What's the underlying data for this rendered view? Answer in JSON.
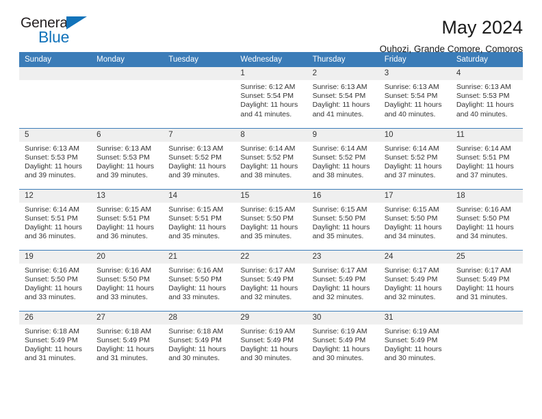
{
  "brand": {
    "name_top": "General",
    "name_bottom": "Blue",
    "accent_color": "#1273ba"
  },
  "header": {
    "title": "May 2024",
    "subtitle": "Ouhozi, Grande Comore, Comoros"
  },
  "calendar": {
    "header_color": "#3b7cb8",
    "daynum_background": "#efefef",
    "weekday_names": [
      "Sunday",
      "Monday",
      "Tuesday",
      "Wednesday",
      "Thursday",
      "Friday",
      "Saturday"
    ],
    "weeks": [
      [
        {
          "day": ""
        },
        {
          "day": ""
        },
        {
          "day": ""
        },
        {
          "day": "1",
          "sunrise": "Sunrise: 6:12 AM",
          "sunset": "Sunset: 5:54 PM",
          "daylight_line1": "Daylight: 11 hours",
          "daylight_line2": "and 41 minutes."
        },
        {
          "day": "2",
          "sunrise": "Sunrise: 6:13 AM",
          "sunset": "Sunset: 5:54 PM",
          "daylight_line1": "Daylight: 11 hours",
          "daylight_line2": "and 41 minutes."
        },
        {
          "day": "3",
          "sunrise": "Sunrise: 6:13 AM",
          "sunset": "Sunset: 5:54 PM",
          "daylight_line1": "Daylight: 11 hours",
          "daylight_line2": "and 40 minutes."
        },
        {
          "day": "4",
          "sunrise": "Sunrise: 6:13 AM",
          "sunset": "Sunset: 5:53 PM",
          "daylight_line1": "Daylight: 11 hours",
          "daylight_line2": "and 40 minutes."
        }
      ],
      [
        {
          "day": "5",
          "sunrise": "Sunrise: 6:13 AM",
          "sunset": "Sunset: 5:53 PM",
          "daylight_line1": "Daylight: 11 hours",
          "daylight_line2": "and 39 minutes."
        },
        {
          "day": "6",
          "sunrise": "Sunrise: 6:13 AM",
          "sunset": "Sunset: 5:53 PM",
          "daylight_line1": "Daylight: 11 hours",
          "daylight_line2": "and 39 minutes."
        },
        {
          "day": "7",
          "sunrise": "Sunrise: 6:13 AM",
          "sunset": "Sunset: 5:52 PM",
          "daylight_line1": "Daylight: 11 hours",
          "daylight_line2": "and 39 minutes."
        },
        {
          "day": "8",
          "sunrise": "Sunrise: 6:14 AM",
          "sunset": "Sunset: 5:52 PM",
          "daylight_line1": "Daylight: 11 hours",
          "daylight_line2": "and 38 minutes."
        },
        {
          "day": "9",
          "sunrise": "Sunrise: 6:14 AM",
          "sunset": "Sunset: 5:52 PM",
          "daylight_line1": "Daylight: 11 hours",
          "daylight_line2": "and 38 minutes."
        },
        {
          "day": "10",
          "sunrise": "Sunrise: 6:14 AM",
          "sunset": "Sunset: 5:52 PM",
          "daylight_line1": "Daylight: 11 hours",
          "daylight_line2": "and 37 minutes."
        },
        {
          "day": "11",
          "sunrise": "Sunrise: 6:14 AM",
          "sunset": "Sunset: 5:51 PM",
          "daylight_line1": "Daylight: 11 hours",
          "daylight_line2": "and 37 minutes."
        }
      ],
      [
        {
          "day": "12",
          "sunrise": "Sunrise: 6:14 AM",
          "sunset": "Sunset: 5:51 PM",
          "daylight_line1": "Daylight: 11 hours",
          "daylight_line2": "and 36 minutes."
        },
        {
          "day": "13",
          "sunrise": "Sunrise: 6:15 AM",
          "sunset": "Sunset: 5:51 PM",
          "daylight_line1": "Daylight: 11 hours",
          "daylight_line2": "and 36 minutes."
        },
        {
          "day": "14",
          "sunrise": "Sunrise: 6:15 AM",
          "sunset": "Sunset: 5:51 PM",
          "daylight_line1": "Daylight: 11 hours",
          "daylight_line2": "and 35 minutes."
        },
        {
          "day": "15",
          "sunrise": "Sunrise: 6:15 AM",
          "sunset": "Sunset: 5:50 PM",
          "daylight_line1": "Daylight: 11 hours",
          "daylight_line2": "and 35 minutes."
        },
        {
          "day": "16",
          "sunrise": "Sunrise: 6:15 AM",
          "sunset": "Sunset: 5:50 PM",
          "daylight_line1": "Daylight: 11 hours",
          "daylight_line2": "and 35 minutes."
        },
        {
          "day": "17",
          "sunrise": "Sunrise: 6:15 AM",
          "sunset": "Sunset: 5:50 PM",
          "daylight_line1": "Daylight: 11 hours",
          "daylight_line2": "and 34 minutes."
        },
        {
          "day": "18",
          "sunrise": "Sunrise: 6:16 AM",
          "sunset": "Sunset: 5:50 PM",
          "daylight_line1": "Daylight: 11 hours",
          "daylight_line2": "and 34 minutes."
        }
      ],
      [
        {
          "day": "19",
          "sunrise": "Sunrise: 6:16 AM",
          "sunset": "Sunset: 5:50 PM",
          "daylight_line1": "Daylight: 11 hours",
          "daylight_line2": "and 33 minutes."
        },
        {
          "day": "20",
          "sunrise": "Sunrise: 6:16 AM",
          "sunset": "Sunset: 5:50 PM",
          "daylight_line1": "Daylight: 11 hours",
          "daylight_line2": "and 33 minutes."
        },
        {
          "day": "21",
          "sunrise": "Sunrise: 6:16 AM",
          "sunset": "Sunset: 5:50 PM",
          "daylight_line1": "Daylight: 11 hours",
          "daylight_line2": "and 33 minutes."
        },
        {
          "day": "22",
          "sunrise": "Sunrise: 6:17 AM",
          "sunset": "Sunset: 5:49 PM",
          "daylight_line1": "Daylight: 11 hours",
          "daylight_line2": "and 32 minutes."
        },
        {
          "day": "23",
          "sunrise": "Sunrise: 6:17 AM",
          "sunset": "Sunset: 5:49 PM",
          "daylight_line1": "Daylight: 11 hours",
          "daylight_line2": "and 32 minutes."
        },
        {
          "day": "24",
          "sunrise": "Sunrise: 6:17 AM",
          "sunset": "Sunset: 5:49 PM",
          "daylight_line1": "Daylight: 11 hours",
          "daylight_line2": "and 32 minutes."
        },
        {
          "day": "25",
          "sunrise": "Sunrise: 6:17 AM",
          "sunset": "Sunset: 5:49 PM",
          "daylight_line1": "Daylight: 11 hours",
          "daylight_line2": "and 31 minutes."
        }
      ],
      [
        {
          "day": "26",
          "sunrise": "Sunrise: 6:18 AM",
          "sunset": "Sunset: 5:49 PM",
          "daylight_line1": "Daylight: 11 hours",
          "daylight_line2": "and 31 minutes."
        },
        {
          "day": "27",
          "sunrise": "Sunrise: 6:18 AM",
          "sunset": "Sunset: 5:49 PM",
          "daylight_line1": "Daylight: 11 hours",
          "daylight_line2": "and 31 minutes."
        },
        {
          "day": "28",
          "sunrise": "Sunrise: 6:18 AM",
          "sunset": "Sunset: 5:49 PM",
          "daylight_line1": "Daylight: 11 hours",
          "daylight_line2": "and 30 minutes."
        },
        {
          "day": "29",
          "sunrise": "Sunrise: 6:19 AM",
          "sunset": "Sunset: 5:49 PM",
          "daylight_line1": "Daylight: 11 hours",
          "daylight_line2": "and 30 minutes."
        },
        {
          "day": "30",
          "sunrise": "Sunrise: 6:19 AM",
          "sunset": "Sunset: 5:49 PM",
          "daylight_line1": "Daylight: 11 hours",
          "daylight_line2": "and 30 minutes."
        },
        {
          "day": "31",
          "sunrise": "Sunrise: 6:19 AM",
          "sunset": "Sunset: 5:49 PM",
          "daylight_line1": "Daylight: 11 hours",
          "daylight_line2": "and 30 minutes."
        },
        {
          "day": ""
        }
      ]
    ]
  }
}
